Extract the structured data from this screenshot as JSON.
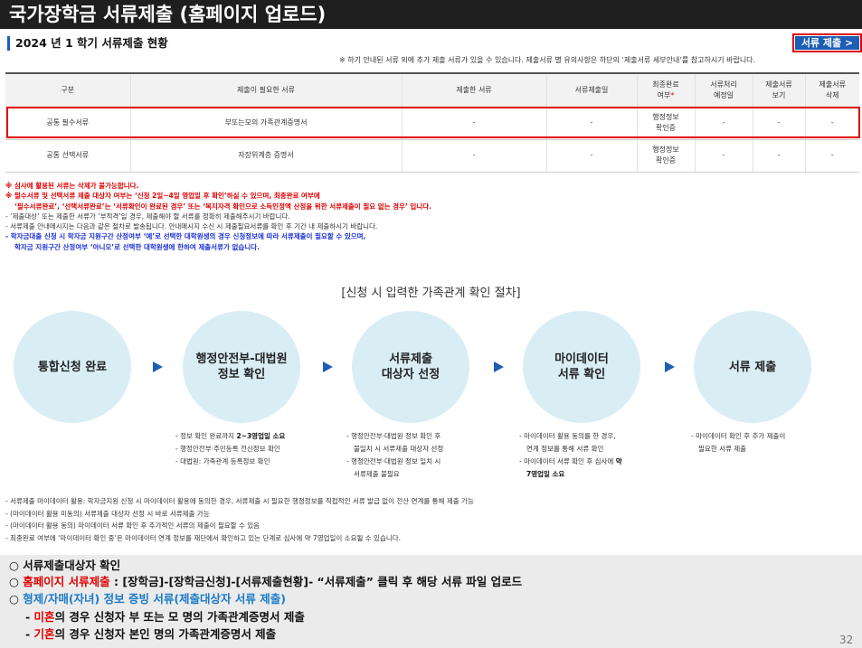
{
  "page": {
    "title": "국가장학금 서류제출 (홈페이지 업로드)",
    "number": "32"
  },
  "section": {
    "heading": "2024 년 1 학기 서류제출 현황",
    "button_label": "서류 제출 >",
    "note": "※ 하기 안내된 서류 외에 추가 제출 서류가 있을 수 있습니다. 제출서류 별 유의사항은 하단의 ‘제출서류 세부안내’를 참고하시기 바랍니다."
  },
  "table": {
    "headers": [
      "구분",
      "제출이 필요한 서류",
      "제출한 서류",
      "서류제출일",
      "최종완료",
      "여부",
      "*",
      "서류처리",
      "예정일",
      "제출서류",
      "보기",
      "제출서류",
      "삭제"
    ],
    "rows": [
      [
        "공통 필수서류",
        "부또는모의 가족관계증명서",
        "-",
        "-",
        "행정정보",
        "확인증",
        "-",
        "-",
        "-"
      ],
      [
        "공통 선택서류",
        "자장위계층 증명서",
        "-",
        "-",
        "행정정보",
        "확인증",
        "-",
        "-",
        "-"
      ]
    ]
  },
  "notes": [
    "※ 심사에 활용된 서류는 삭제가 불가능합니다.",
    "※ 필수서류 및 선택서류 제출 대상자 여부는 ‘신청 2일~4일 영업일 후 확인’하실 수 있으며, 최종완료 여부에",
    "‘필수서류완료’, ‘선택서류완료’는 ‘서류확인이 완료된 경우’ 또는 ‘복지자격 확인으로 소득인정액 산정을 위한 서류제출이 필요 없는 경우’ 입니다.",
    "- ‘제출대상’ 또는 제출한 서류가 ‘부적격’일 경우, 제출해야 할 서류를 정확히 제출해주시기 바랍니다.",
    "- 서류제출 안내메시지는 다음과 같은 절차로 발송됩니다. 안내메시지 수신 시 제출필요서류를 확인 후 기간 내 제출하시기 바랍니다.",
    "- 학자금대출 신청 시 학자금 지원구간 산정여부 ‘예’로 선택한 대학원생의 경우 신청정보에 따라 서류제출이 필요할 수 있으며,",
    "학자금 지원구간 산정여부 ‘아니오’로 선택한 대학원생에 한하여 제출서류가 없습니다."
  ],
  "process": {
    "title": "[신청 시 입력한 가족관계 확인 절차]",
    "steps": [
      {
        "line1": "통합신청 완료",
        "line2": ""
      },
      {
        "line1": "행정안전부-대법원",
        "line2": "정보 확인"
      },
      {
        "line1": "서류제출",
        "line2": "대상자 선정"
      },
      {
        "line1": "마이데이터",
        "line2": "서류 확인"
      },
      {
        "line1": "서류 제출",
        "line2": ""
      }
    ],
    "step_notes": [
      [
        "- 정보 확인 완료까지 ",
        "2~3영업일 소요",
        "- 행정안전부·주민등록 전산정보 확인",
        "- 대법원: 가족관계 등록정보 확인"
      ],
      [
        "- 행정안전부·대법원 정보 확인 후",
        "불일치 시 서류제출 대상자 선정",
        "- 행정안전부·대법원 정보 일치 시",
        "서류제출 불필요"
      ],
      [
        "- 마이데이터 활용 동의를 한 경우,",
        "연계 정보를 통해 서류 확인",
        "- 마이데이터 서류 확인 후 심사에 ",
        "약",
        "7영업일 소요"
      ],
      [
        "- 마이데이터 확인 후 추가 제출이",
        "필요한 서류 제출"
      ]
    ]
  },
  "flow_notes": [
    "- 서류제출 마이데이터 활용: 학자금지원 신청 시 마이데이터 활용에 동의한 경우, 서류제출 시 필요한 행정정보를 직접적인 서류 발급 없이 전산 연계를 통해 제출 가능",
    "- (마이데이터 활용 미동의) 서류제출 대상자 선정 시 바로 서류제출 가능",
    "- (마이데이터 활용 동의) 마이데이터 서류 확인 후 추가적인 서류의 제출이 필요할 수 있음",
    "- 최종완료 여부에 ‘마이데이터 확인 중’은 마이데이터 연계 정보를 재단에서 확인하고 있는 단계로 심사에 약 7영업일이 소요될 수 있습니다."
  ],
  "footer": {
    "l1": "○ 서류제출대상자 확인",
    "l2_prefix": "○ ",
    "l2_red": "홈페이지 서류제출",
    "l2_rest": " : [장학금]-[장학금신청]-[서류제출현황]- “서류제출” 클릭 후 해당 서류 파일 업로드",
    "l3_prefix": "○ ",
    "l3_blue": "형제/자매(자녀) 정보 증빙 서류(제출대상자 서류 제출)",
    "l4_prefix": "- ",
    "l4_red": "미혼",
    "l4_rest": "의 경우 신청자 부 또는 모 명의 가족관계증명서 제출",
    "l5_prefix": "- ",
    "l5_red": "기혼",
    "l5_rest": "의 경우 신청자 본인 명의 가족관계증명서 제출"
  },
  "colors": {
    "title_bg": "#1f1f1f",
    "accent_blue": "#1c5db5",
    "highlight_red": "#e00000",
    "circle_fill": "#d9edf4",
    "footer_bg": "#ebebeb"
  }
}
